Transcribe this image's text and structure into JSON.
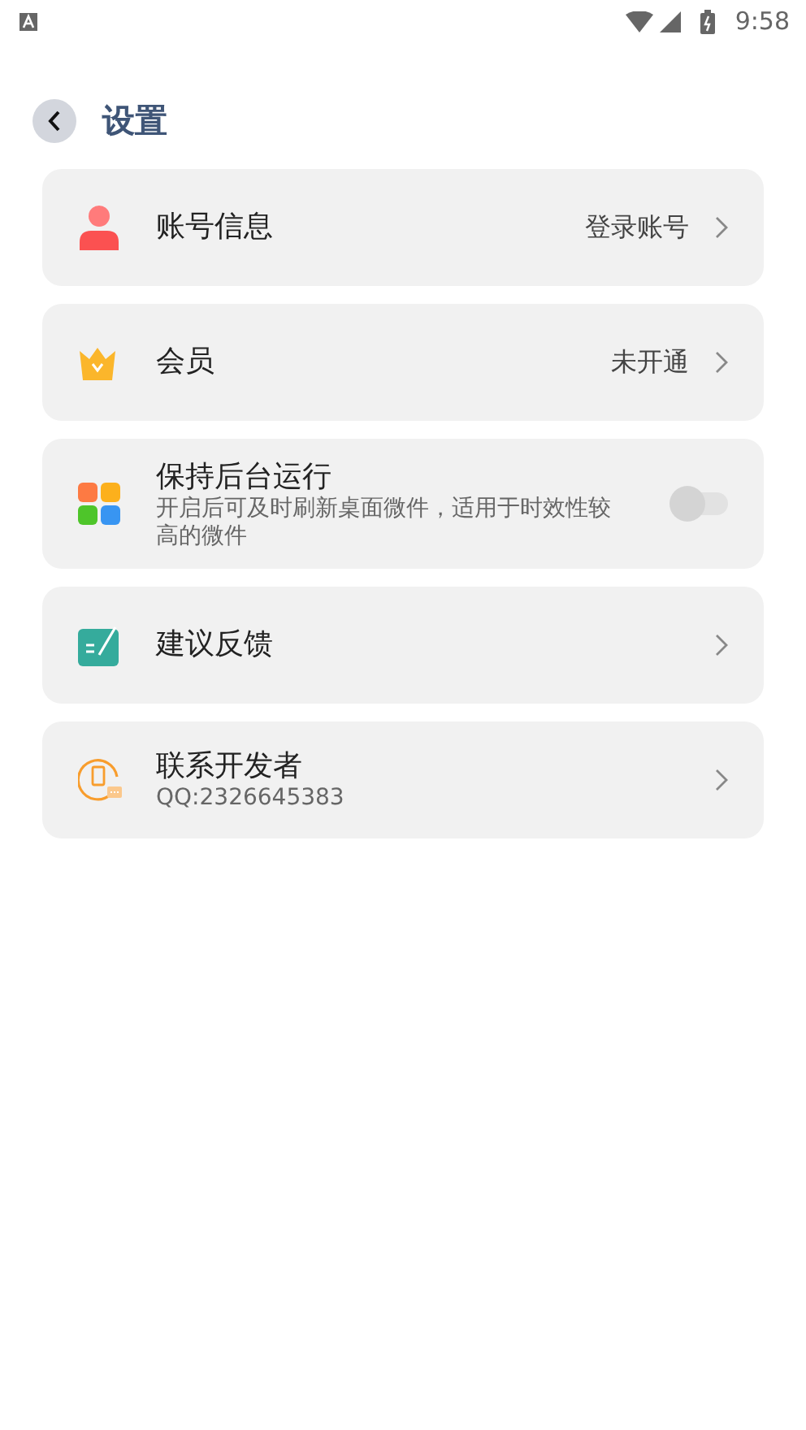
{
  "status_bar": {
    "time": "9:58"
  },
  "header": {
    "title": "设置"
  },
  "items": [
    {
      "kind": "link",
      "title": "账号信息",
      "value": "登录账号"
    },
    {
      "kind": "link",
      "title": "会员",
      "value": "未开通"
    },
    {
      "kind": "toggle",
      "title": "保持后台运行",
      "subtitle": "开启后可及时刷新桌面微件，适用于时效性较高的微件",
      "on": false
    },
    {
      "kind": "link",
      "title": "建议反馈"
    },
    {
      "kind": "link",
      "title": "联系开发者",
      "subtitle": "QQ:2326645383"
    }
  ]
}
